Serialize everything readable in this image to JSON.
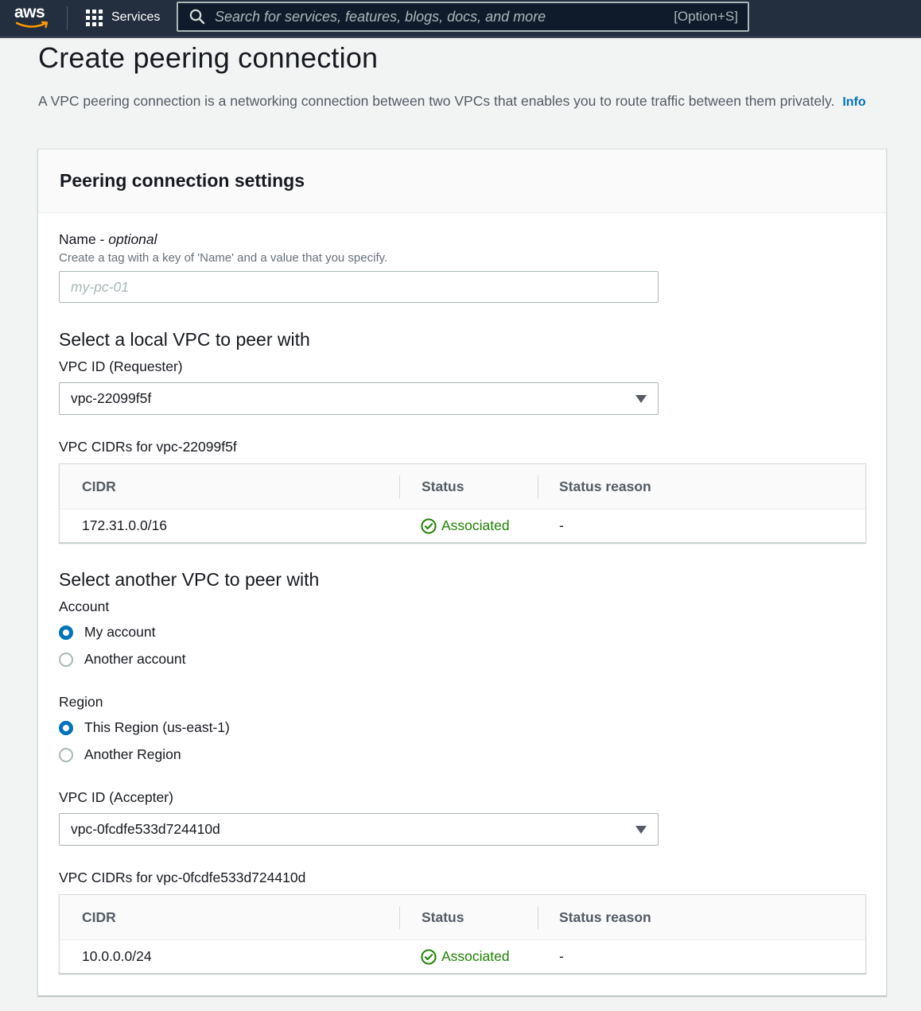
{
  "nav": {
    "logo": "aws",
    "services_label": "Services",
    "search_placeholder": "Search for services, features, blogs, docs, and more",
    "search_shortcut": "[Option+S]"
  },
  "page": {
    "title": "Create peering connection",
    "description": "A VPC peering connection is a networking connection between two VPCs that enables you to route traffic between them privately.",
    "info_link": "Info"
  },
  "settings": {
    "title": "Peering connection settings",
    "name": {
      "label": "Name - ",
      "label_optional": "optional",
      "hint": "Create a tag with a key of 'Name' and a value that you specify.",
      "placeholder": "my-pc-01",
      "value": ""
    },
    "local": {
      "section_title": "Select a local VPC to peer with",
      "vpc_label": "VPC ID (Requester)",
      "vpc_value": "vpc-22099f5f",
      "cidrs_title": "VPC CIDRs for vpc-22099f5f",
      "columns": [
        "CIDR",
        "Status",
        "Status reason"
      ],
      "rows": [
        {
          "cidr": "172.31.0.0/16",
          "status": "Associated",
          "reason": "-"
        }
      ]
    },
    "peer": {
      "section_title": "Select another VPC to peer with",
      "account_label": "Account",
      "account_options": [
        "My account",
        "Another account"
      ],
      "account_selected": 0,
      "region_label": "Region",
      "region_options": [
        "This Region (us-east-1)",
        "Another Region"
      ],
      "region_selected": 0,
      "vpc_label": "VPC ID (Accepter)",
      "vpc_value": "vpc-0fcdfe533d724410d",
      "cidrs_title": "VPC CIDRs for vpc-0fcdfe533d724410d",
      "columns": [
        "CIDR",
        "Status",
        "Status reason"
      ],
      "rows": [
        {
          "cidr": "10.0.0.0/24",
          "status": "Associated",
          "reason": "-"
        }
      ]
    }
  },
  "colors": {
    "nav_bg": "#232f3e",
    "link": "#0073bb",
    "success": "#1d8102",
    "radio_selected": "#0073bb"
  },
  "icons": {
    "search": "search-icon",
    "services": "grid-icon",
    "status": "check-circle-icon",
    "select": "caret-down-icon"
  }
}
